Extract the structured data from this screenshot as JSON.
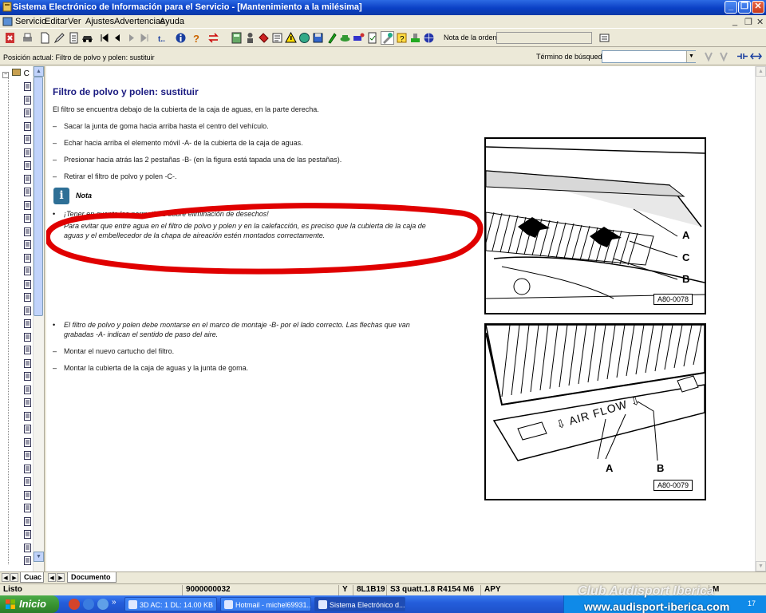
{
  "window": {
    "title": "Sistema Electrónico de Información para el Servicio - [Mantenimiento a la milésima]"
  },
  "menu": {
    "items": [
      "Servicio",
      "Editar",
      "Ver",
      "Ajustes",
      "Advertencias",
      "Ayuda"
    ]
  },
  "toolbar": {
    "order_note_label": "Nota de la orden:",
    "order_note_value": ""
  },
  "position_bar": {
    "current_position": "Posición actual: Filtro de polvo y polen: sustituir",
    "search_label": "Término de búsqueda:",
    "search_value": ""
  },
  "tree": {
    "root_label": "C"
  },
  "document": {
    "title": "Filtro de polvo y polen: sustituir",
    "intro": "El filtro se encuentra debajo de la cubierta de la caja de aguas, en la parte derecha.",
    "steps": [
      "Sacar la junta de goma hacia arriba hasta el centro del vehículo.",
      "Echar hacia arriba el elemento móvil -A- de la cubierta de la caja de aguas.",
      "Presionar hacia atrás las 2 pestañas -B- (en la figura está tapada una de las pestañas).",
      "Retirar el filtro de polvo y polen -C-."
    ],
    "note_label": "Nota",
    "note_bullets": [
      "¡Tener en cuenta las normativas sobre eliminación de desechos!",
      "Para evitar que entre agua en el filtro de polvo y polen y en la calefacción, es preciso que la cubierta de la caja de",
      "aguas y el embellecedor de la chapa de aireación estén montados correctamente."
    ],
    "mount_bullet_1": "El filtro de polvo y polen debe montarse en el marco de montaje -B- por el lado correcto. Las flechas que van",
    "mount_bullet_2": "grabadas -A- indican el sentido de paso del aire.",
    "mount_steps": [
      "Montar el nuevo cartucho del filtro.",
      "Montar la cubierta de la caja de aguas y la junta de goma."
    ],
    "figure1": {
      "code": "A80-0078",
      "labels": [
        "A",
        "C",
        "B"
      ]
    },
    "figure2": {
      "code": "A80-0079",
      "labels": [
        "A",
        "B"
      ],
      "airflow_text": "AIR FLOW"
    }
  },
  "tabs": {
    "left_tab": "Cuac",
    "doc_tab": "Documento"
  },
  "status": {
    "ready": "Listo",
    "order_no": "9000000032",
    "flag": "Y",
    "model_code": "8L1B19",
    "model": "S3 quatt.1.8 R4154 M6",
    "engine": "APY",
    "extra": "M"
  },
  "taskbar": {
    "start": "Inicio",
    "tasks": [
      "3D AC: 1 DL: 14.00 KB",
      "Hotmail - michel69931...",
      "Sistema Electrónico d..."
    ],
    "watermark_1": "Club Audisport Iberica",
    "watermark_2": "www.audisport-iberica.com",
    "clock": "17"
  },
  "colors": {
    "title_bar": "#0a3fc4",
    "doc_title": "#1a1a80",
    "annotation_red": "#e00000",
    "taskbar": "#245edb",
    "start_green": "#36902f"
  }
}
